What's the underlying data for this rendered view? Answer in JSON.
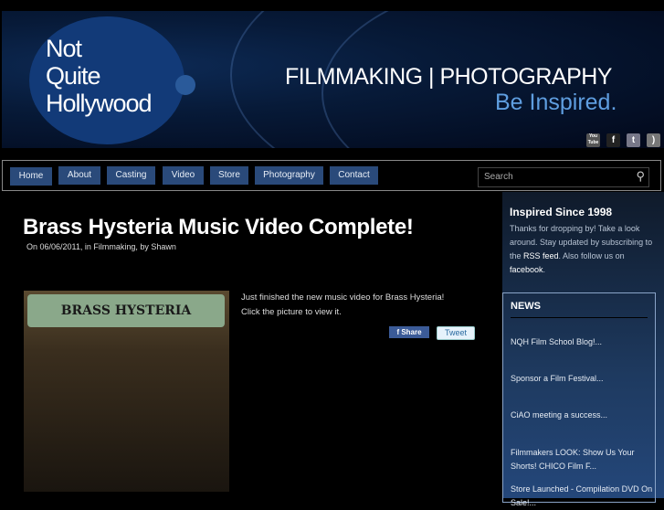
{
  "header": {
    "logo": [
      "Not",
      "Quite",
      "Hollywood"
    ],
    "tagline": "FILMMAKING | PHOTOGRAPHY",
    "subtagline": "Be Inspired.",
    "social": [
      {
        "icon": "youtube-icon",
        "label": "You Tube"
      },
      {
        "icon": "facebook-icon",
        "label": "f"
      },
      {
        "icon": "twitter-icon",
        "label": "t"
      },
      {
        "icon": "rss-icon",
        "label": ")"
      }
    ]
  },
  "nav": {
    "items": [
      "Home",
      "About",
      "Casting",
      "Video",
      "Store",
      "Photography",
      "Contact"
    ],
    "search_placeholder": "Search"
  },
  "post": {
    "title": "Brass Hysteria Music Video Complete!",
    "meta": "On 06/06/2011, in Filmmaking, by Shawn",
    "image_banner": "BRASS HYSTERIA",
    "body_line1": "Just finished the new music video for Brass Hysteria!",
    "body_line2": "Click the picture to view it.",
    "share": "Share",
    "tweet": "Tweet"
  },
  "sidebar": {
    "title": "Inspired Since 1998",
    "text_a": "Thanks for dropping by! Take a look around. Stay updated by subscribing to the ",
    "rss_link": "RSS feed",
    "text_b": ". Also follow us on ",
    "fb_link": "facebook",
    "text_c": ".",
    "news_title": "NEWS",
    "news": [
      "NQH Film School Blog!...",
      "Sponsor a Film Festival...",
      "CiAO meeting a success...",
      "Filmmakers LOOK: Show Us Your Shorts! CHICO Film F...",
      "Store Launched - Compilation DVD On Sale!..."
    ]
  }
}
